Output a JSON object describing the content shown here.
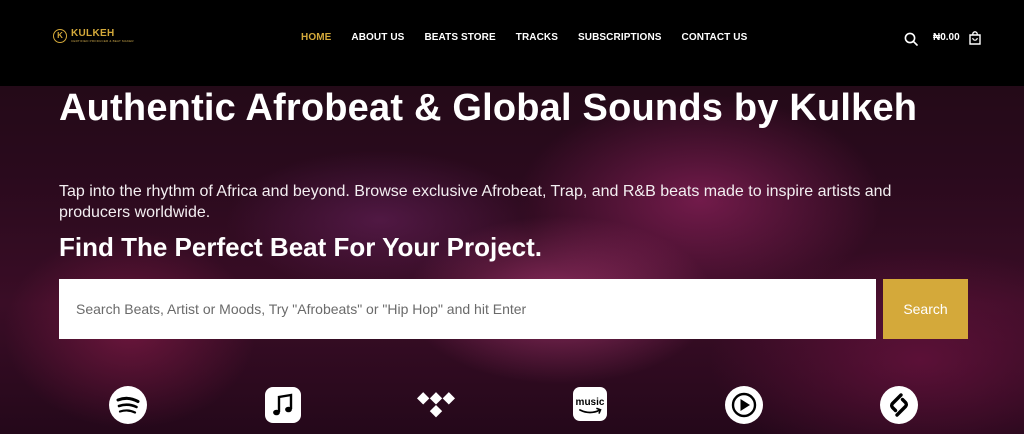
{
  "header": {
    "logo_name": "KULKEH",
    "logo_tagline": "CERTIFIED PRODUCER & BEAT MAKER",
    "nav": [
      {
        "label": "HOME",
        "active": true
      },
      {
        "label": "ABOUT US",
        "active": false
      },
      {
        "label": "BEATS STORE",
        "active": false
      },
      {
        "label": "TRACKS",
        "active": false
      },
      {
        "label": "SUBSCRIPTIONS",
        "active": false
      },
      {
        "label": "CONTACT US",
        "active": false
      }
    ],
    "cart_amount": "₦0.00",
    "search_icon": "search-icon",
    "cart_icon": "shopping-bag-icon"
  },
  "hero": {
    "title": "Authentic Afrobeat & Global Sounds by Kulkeh",
    "subtitle": "Tap into the rhythm of Africa and beyond. Browse exclusive Afrobeat, Trap, and R&B beats made to inspire artists and producers worldwide.",
    "heading": "Find The Perfect Beat For Your Project.",
    "search": {
      "placeholder": "Search Beats, Artist or Moods, Try \"Afrobeats\" or \"Hip Hop\" and hit Enter",
      "value": "",
      "button_label": "Search"
    }
  },
  "platforms": [
    {
      "name": "spotify-icon"
    },
    {
      "name": "apple-music-icon"
    },
    {
      "name": "tidal-icon"
    },
    {
      "name": "amazon-music-icon",
      "label": "music"
    },
    {
      "name": "youtube-music-icon"
    },
    {
      "name": "shazam-icon"
    }
  ],
  "colors": {
    "accent": "#d4a93a",
    "header_bg": "#000000",
    "hero_bg": "#2a0a1d"
  }
}
